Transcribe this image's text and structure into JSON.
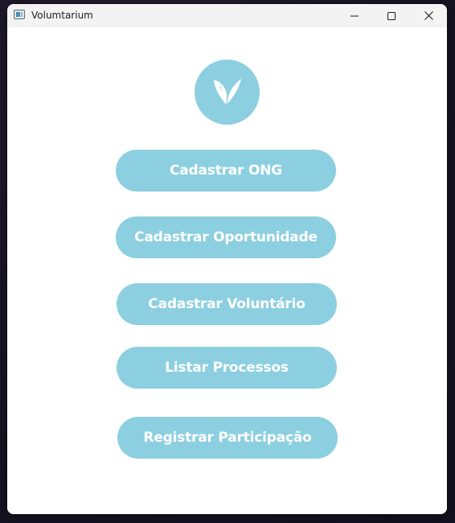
{
  "window": {
    "title": "Volumtarium",
    "icon": "app-window-icon",
    "controls": [
      "minimize-icon",
      "maximize-icon",
      "close-icon"
    ]
  },
  "logo": {
    "icon": "leaf-v-logo-icon",
    "color": "#8ccfe0"
  },
  "menu": {
    "buttons": [
      {
        "label": "Cadastrar ONG"
      },
      {
        "label": "Cadastrar Oportunidade"
      },
      {
        "label": "Cadastrar Voluntário"
      },
      {
        "label": "Listar Processos"
      },
      {
        "label": "Registrar Participação"
      }
    ]
  },
  "colors": {
    "accent": "#8ccfe0",
    "button_text": "#ffffff",
    "background": "#ffffff",
    "titlebar": "#f3f3f3"
  }
}
